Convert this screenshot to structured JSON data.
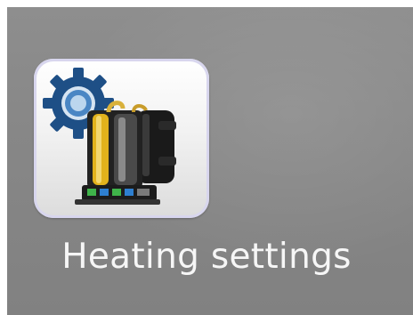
{
  "launcher": {
    "item": {
      "label": "Heating settings",
      "icon": "gear-compressor-icon"
    }
  },
  "colors": {
    "background": "#878787",
    "label": "#f6f6f6",
    "tile_border": "#d8d6ee",
    "gear": "#1e4f86",
    "compressor_accent": "#e2b21c"
  }
}
